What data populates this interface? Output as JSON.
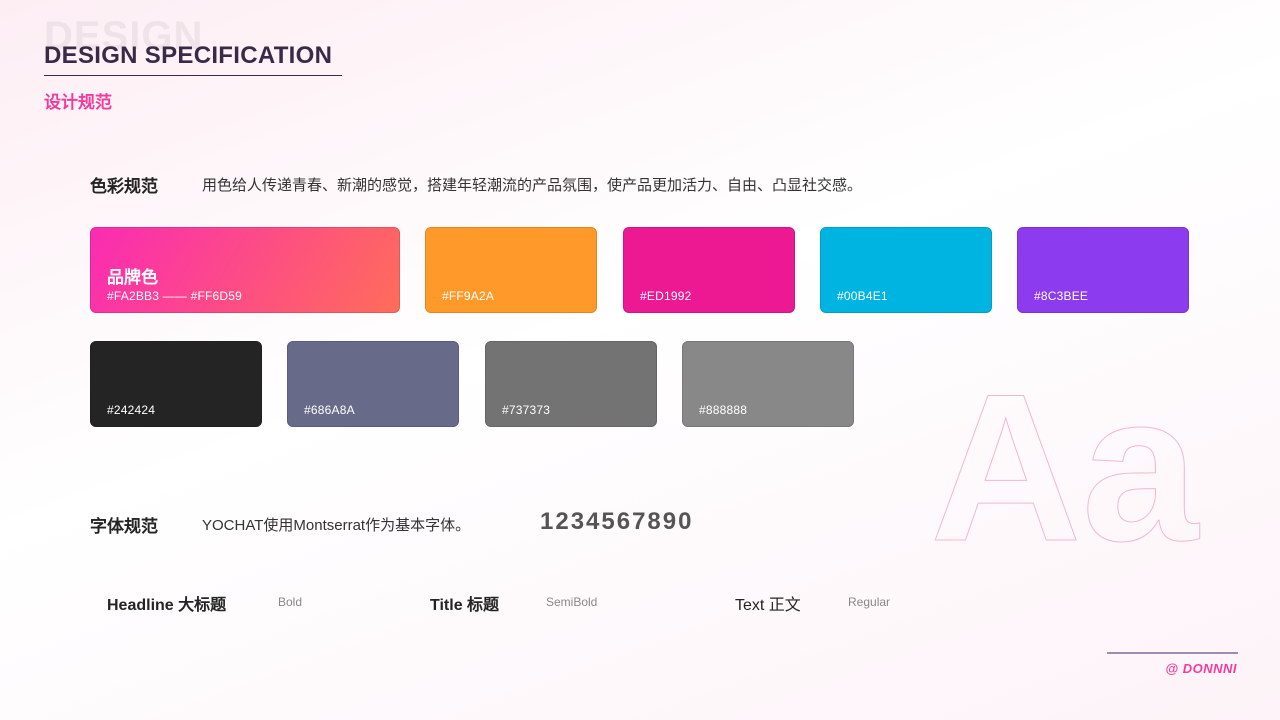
{
  "header": {
    "ghost_word": "DESIGN",
    "title": "DESIGN SPECIFICATION",
    "subtitle": "设计规范"
  },
  "color_section": {
    "label": "色彩规范",
    "description": "用色给人传递青春、新潮的感觉，搭建年轻潮流的产品氛围，使产品更加活力、自由、凸显社交感。",
    "brand": {
      "name": "品牌色",
      "hex_label": "#FA2BB3 —— #FF6D59",
      "from": "#FA2BB3",
      "to": "#FF6D59"
    },
    "primary": [
      {
        "hex": "#FF9A2A"
      },
      {
        "hex": "#ED1992"
      },
      {
        "hex": "#00B4E1"
      },
      {
        "hex": "#8C3BEE"
      }
    ],
    "neutrals": [
      {
        "hex": "#242424"
      },
      {
        "hex": "#686A8A"
      },
      {
        "hex": "#737373"
      },
      {
        "hex": "#888888"
      }
    ]
  },
  "font_section": {
    "label": "字体规范",
    "description": "YOCHAT使用Montserrat作为基本字体。",
    "digits": "1234567890",
    "sample_glyphs": "Aa",
    "styles": [
      {
        "name": "Headline 大标题",
        "weight": "Bold"
      },
      {
        "name": "Title 标题",
        "weight": "SemiBold"
      },
      {
        "name": "Text 正文",
        "weight": "Regular"
      }
    ]
  },
  "footer": {
    "credit": "@ DONNNI"
  },
  "colors": {
    "accent": "#F23C9B",
    "title": "#3A2A48"
  }
}
